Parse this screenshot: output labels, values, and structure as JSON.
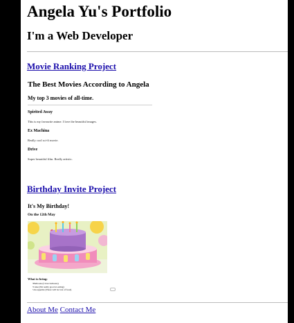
{
  "header": {
    "title": "Angela Yu's Portfolio",
    "subtitle": "I'm a Web Developer"
  },
  "projects": [
    {
      "link_label": "Movie Ranking Project",
      "preview": {
        "heading": "The Best Movies According to Angela",
        "subheading": "My top 3 movies of all-time.",
        "movies": [
          {
            "title": "Spirited Away",
            "description": "This is my favourite anime. I love the beautiful images."
          },
          {
            "title": "Ex Machina",
            "description": "Really cool sci-fi movie."
          },
          {
            "title": "Drive",
            "description": "Super beautiful film. Really artistic."
          }
        ]
      }
    },
    {
      "link_label": "Birthday Invite Project",
      "preview": {
        "heading": "It's My Birthday!",
        "date": "On the 12th May",
        "what_to_bring_label": "What to bring:",
        "items": [
          "Balloons (I love balloons)",
          "Cake (I'm really good at eating)",
          "An appetite (There will be lots of food)"
        ]
      }
    }
  ],
  "footer": {
    "about_label": "About Me",
    "contact_label": "Contact Me"
  },
  "colors": {
    "link": "#1a0dab",
    "background": "#000000",
    "page": "#ffffff"
  }
}
